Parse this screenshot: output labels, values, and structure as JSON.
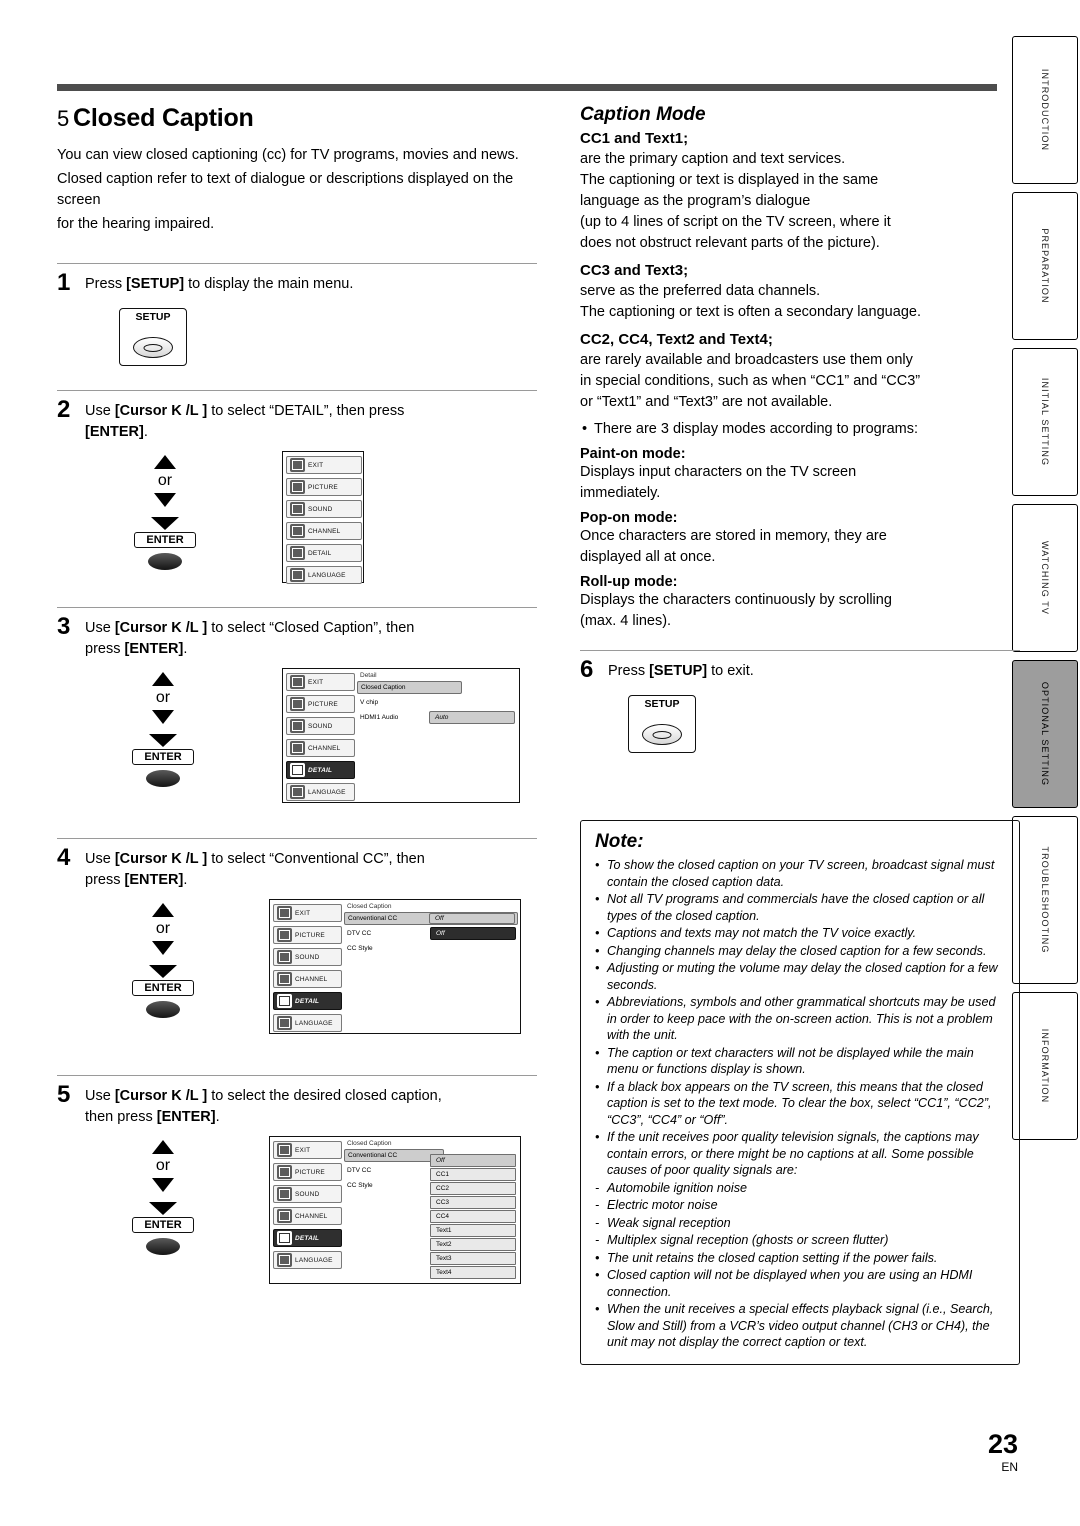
{
  "page": {
    "number": "23",
    "lang": "EN"
  },
  "tabs": [
    {
      "label": "INTRODUCTION",
      "active": false
    },
    {
      "label": "PREPARATION",
      "active": false
    },
    {
      "label": "INITIAL SETTING",
      "active": false
    },
    {
      "label": "WATCHING TV",
      "active": false
    },
    {
      "label": "OPTIONAL SETTING",
      "active": true
    },
    {
      "label": "TROUBLESHOOTING",
      "active": false
    },
    {
      "label": "INFORMATION",
      "active": false
    }
  ],
  "left": {
    "title": "Closed Caption",
    "title_dingbat": "5",
    "intro": [
      "You can view closed captioning (cc) for TV programs, movies and news.",
      "Closed caption refer to text of dialogue or descriptions displayed on the screen",
      "for the hearing impaired."
    ],
    "steps": [
      {
        "num": "1",
        "text": "Press [SETUP] to display the main menu.",
        "bold": "SETUP"
      },
      {
        "num": "2",
        "text": "Use [Cursor K /L ] to select “DETAIL”, then press [ENTER]."
      },
      {
        "num": "3",
        "text": "Use [Cursor K /L ] to select “Closed Caption”, then press [ENTER]."
      },
      {
        "num": "4",
        "text": "Use [Cursor K /L ] to select “Conventional CC”, then press [ENTER]."
      },
      {
        "num": "5",
        "text": "Use [Cursor K /L ] to select the desired closed caption, then press [ENTER]."
      }
    ],
    "setup_key_label": "SETUP",
    "enter_key_label": "ENTER",
    "or_label": "or",
    "menu_items": [
      "EXIT",
      "PICTURE",
      "SOUND",
      "CHANNEL",
      "DETAIL",
      "LANGUAGE"
    ],
    "osd2": {
      "selected": "LANGUAGE"
    },
    "osd3": {
      "title": "Detail",
      "selected_side": "DETAIL",
      "rows": [
        {
          "label": "Closed Caption",
          "value": "",
          "highlight": true
        },
        {
          "label": "V chip",
          "value": "",
          "highlight": false
        },
        {
          "label": "HDMI1 Audio",
          "value": "Auto",
          "highlight": false
        }
      ]
    },
    "osd4": {
      "title": "Closed Caption",
      "selected_side": "DETAIL",
      "rows": [
        {
          "label": "Conventional CC",
          "value": "Off",
          "highlight": true
        },
        {
          "label": "DTV CC",
          "value": "Off",
          "highlight": false
        },
        {
          "label": "CC Style",
          "value": "",
          "highlight": false
        }
      ]
    },
    "osd5": {
      "title": "Closed Caption",
      "selected_side": "DETAIL",
      "rows": [
        {
          "label": "Conventional CC",
          "value": "Off",
          "highlight": true
        },
        {
          "label": "DTV CC",
          "value": "",
          "highlight": false
        },
        {
          "label": "CC Style",
          "value": "",
          "highlight": false
        }
      ],
      "options": [
        "Off",
        "CC1",
        "CC2",
        "CC3",
        "CC4",
        "Text1",
        "Text2",
        "Text3",
        "Text4"
      ]
    }
  },
  "right": {
    "caption_mode_title": "Caption Mode",
    "sections": [
      {
        "heading": "CC1 and Text1;",
        "body": [
          "are the primary caption and text services.",
          "The captioning or text is displayed in the same",
          "language as the program’s dialogue",
          "(up to 4 lines of script on the TV screen, where it",
          "does not obstruct relevant parts of the picture)."
        ]
      },
      {
        "heading": "CC3 and Text3;",
        "body": [
          "serve as the preferred data channels.",
          "The captioning or text is often a secondary language."
        ]
      },
      {
        "heading": "CC2, CC4, Text2 and Text4;",
        "body": [
          "are rarely available and broadcasters use them only",
          "in special conditions, such as when “CC1” and “CC3”",
          "or “Text1” and “Text3” are not available."
        ]
      }
    ],
    "bullet": "There are 3 display modes according to programs:",
    "modes": [
      {
        "name": "Paint-on mode:",
        "desc": [
          "Displays input characters on the TV screen",
          "immediately."
        ]
      },
      {
        "name": "Pop-on mode:",
        "desc": [
          "Once characters are stored in memory, they are",
          "displayed all at once."
        ]
      },
      {
        "name": "Roll-up mode:",
        "desc": [
          "Displays the characters continuously by scrolling",
          "(max. 4 lines)."
        ]
      }
    ],
    "step6": {
      "num": "6",
      "text": "Press [SETUP] to exit.",
      "key_label": "SETUP"
    }
  },
  "note": {
    "title": "Note:",
    "items": [
      {
        "text": "To show the closed caption on your TV screen, broadcast signal must contain the closed caption data.",
        "sub": false
      },
      {
        "text": "Not all TV programs and commercials have the closed caption or all types of the closed caption.",
        "sub": false
      },
      {
        "text": "Captions and texts may not match the TV voice exactly.",
        "sub": false
      },
      {
        "text": "Changing channels may delay the closed caption for a few seconds.",
        "sub": false
      },
      {
        "text": "Adjusting or muting the volume may delay the closed caption for a few seconds.",
        "sub": false
      },
      {
        "text": "Abbreviations, symbols and other grammatical shortcuts may be used in order to keep pace with the on-screen action. This is not a problem with the unit.",
        "sub": false
      },
      {
        "text": "The caption or text characters will not be displayed while the main menu or functions display is shown.",
        "sub": false
      },
      {
        "text": "If a black box appears on the TV screen, this means that the closed caption is set to the text mode. To clear the box, select “CC1”, “CC2”, “CC3”, “CC4” or “Off”.",
        "sub": false
      },
      {
        "text": "If the unit receives poor quality television signals, the captions may contain errors, or there might be no captions at all. Some possible causes of poor quality signals are:",
        "sub": false
      },
      {
        "text": "Automobile ignition noise",
        "sub": true
      },
      {
        "text": "Electric motor noise",
        "sub": true
      },
      {
        "text": "Weak signal reception",
        "sub": true
      },
      {
        "text": "Multiplex signal reception (ghosts or screen flutter)",
        "sub": true
      },
      {
        "text": "The unit retains the closed caption setting if the power fails.",
        "sub": false
      },
      {
        "text": "Closed caption will not be displayed when you are using an HDMI connection.",
        "sub": false
      },
      {
        "text": "When the unit receives a special effects playback signal (i.e., Search, Slow and Still) from a VCR’s video output channel (CH3 or CH4), the unit may not display the correct caption or text.",
        "sub": false
      }
    ]
  }
}
